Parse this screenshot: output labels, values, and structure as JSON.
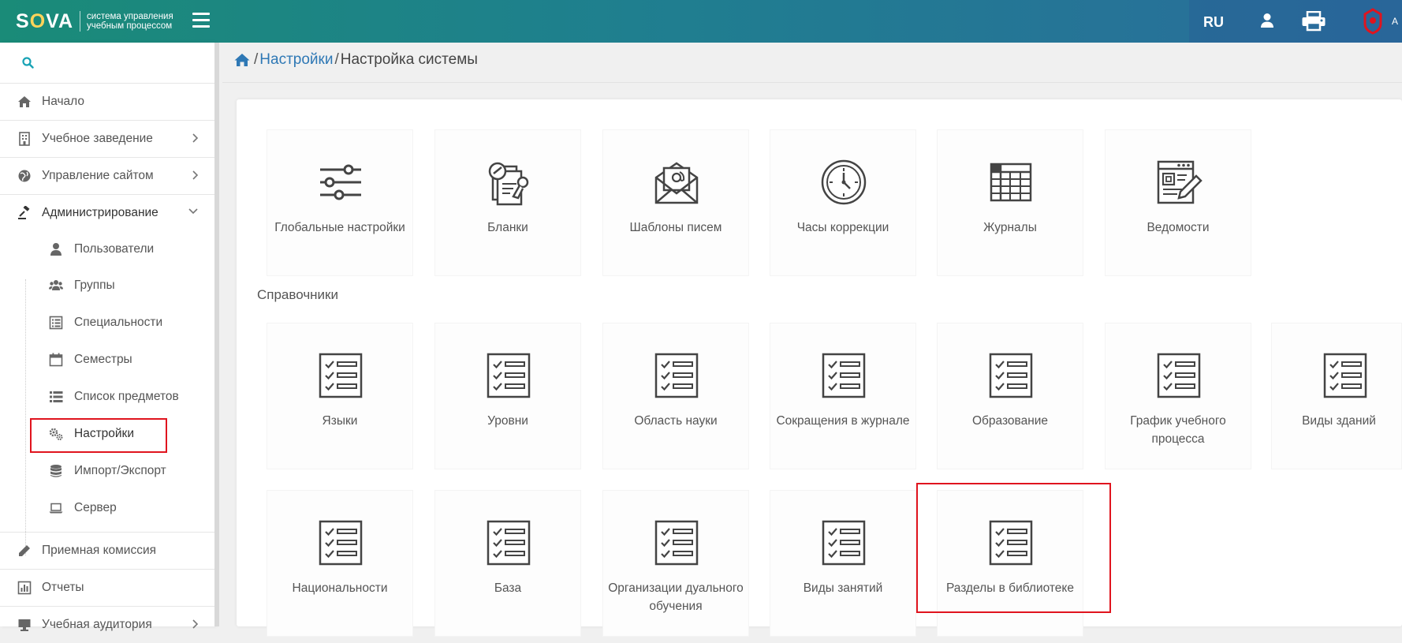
{
  "header": {
    "logo_word_pre": "S",
    "logo_word_o": "O",
    "logo_word_post": "VA",
    "logo_sub_line1": "система управления",
    "logo_sub_line2": "учебным процессом",
    "lang": "RU",
    "cut_text": "A"
  },
  "sidebar": {
    "items": [
      {
        "label": "Начало",
        "icon": "home-icon"
      },
      {
        "label": "Учебное заведение",
        "icon": "building-icon"
      },
      {
        "label": "Управление сайтом",
        "icon": "globe-icon"
      },
      {
        "label": "Администрирование",
        "icon": "gavel-icon"
      },
      {
        "label": "Приемная комиссия",
        "icon": "pencil-icon"
      },
      {
        "label": "Отчеты",
        "icon": "bar-chart-icon"
      },
      {
        "label": "Учебная аудитория",
        "icon": "monitor-icon"
      }
    ],
    "admin_sub": [
      {
        "label": "Пользователи",
        "icon": "user-icon"
      },
      {
        "label": "Группы",
        "icon": "users-icon"
      },
      {
        "label": "Специальности",
        "icon": "list-alt-icon"
      },
      {
        "label": "Семестры",
        "icon": "calendar-icon"
      },
      {
        "label": "Список предметов",
        "icon": "list-icon"
      },
      {
        "label": "Настройки",
        "icon": "gears-icon"
      },
      {
        "label": "Импорт/Экспорт",
        "icon": "database-icon"
      },
      {
        "label": "Сервер",
        "icon": "laptop-icon"
      }
    ]
  },
  "breadcrumb": {
    "level1": "Настройки",
    "level2": "Настройка системы"
  },
  "main": {
    "top_tiles": [
      {
        "label": "Глобальные настройки",
        "icon": "sliders-icon"
      },
      {
        "label": "Бланки",
        "icon": "forms-icon"
      },
      {
        "label": "Шаблоны писем",
        "icon": "email-template-icon"
      },
      {
        "label": "Часы коррекции",
        "icon": "clock-icon"
      },
      {
        "label": "Журналы",
        "icon": "table-grid-icon"
      },
      {
        "label": "Ведомости",
        "icon": "document-edit-icon"
      }
    ],
    "section_title": "Справочники",
    "ref_tiles_row1": [
      {
        "label": "Языки"
      },
      {
        "label": "Уровни"
      },
      {
        "label": "Область науки"
      },
      {
        "label": "Сокращения в журнале"
      },
      {
        "label": "Образование"
      },
      {
        "label": "График учебного процесса"
      },
      {
        "label": "Виды зданий"
      }
    ],
    "ref_tiles_row2": [
      {
        "label": "Национальности"
      },
      {
        "label": "База"
      },
      {
        "label": "Организации дуального обучения"
      },
      {
        "label": "Виды занятий"
      },
      {
        "label": "Разделы в библиотеке"
      }
    ],
    "highlight_color": "#e0141e",
    "accent_link": "#2e78b5"
  }
}
